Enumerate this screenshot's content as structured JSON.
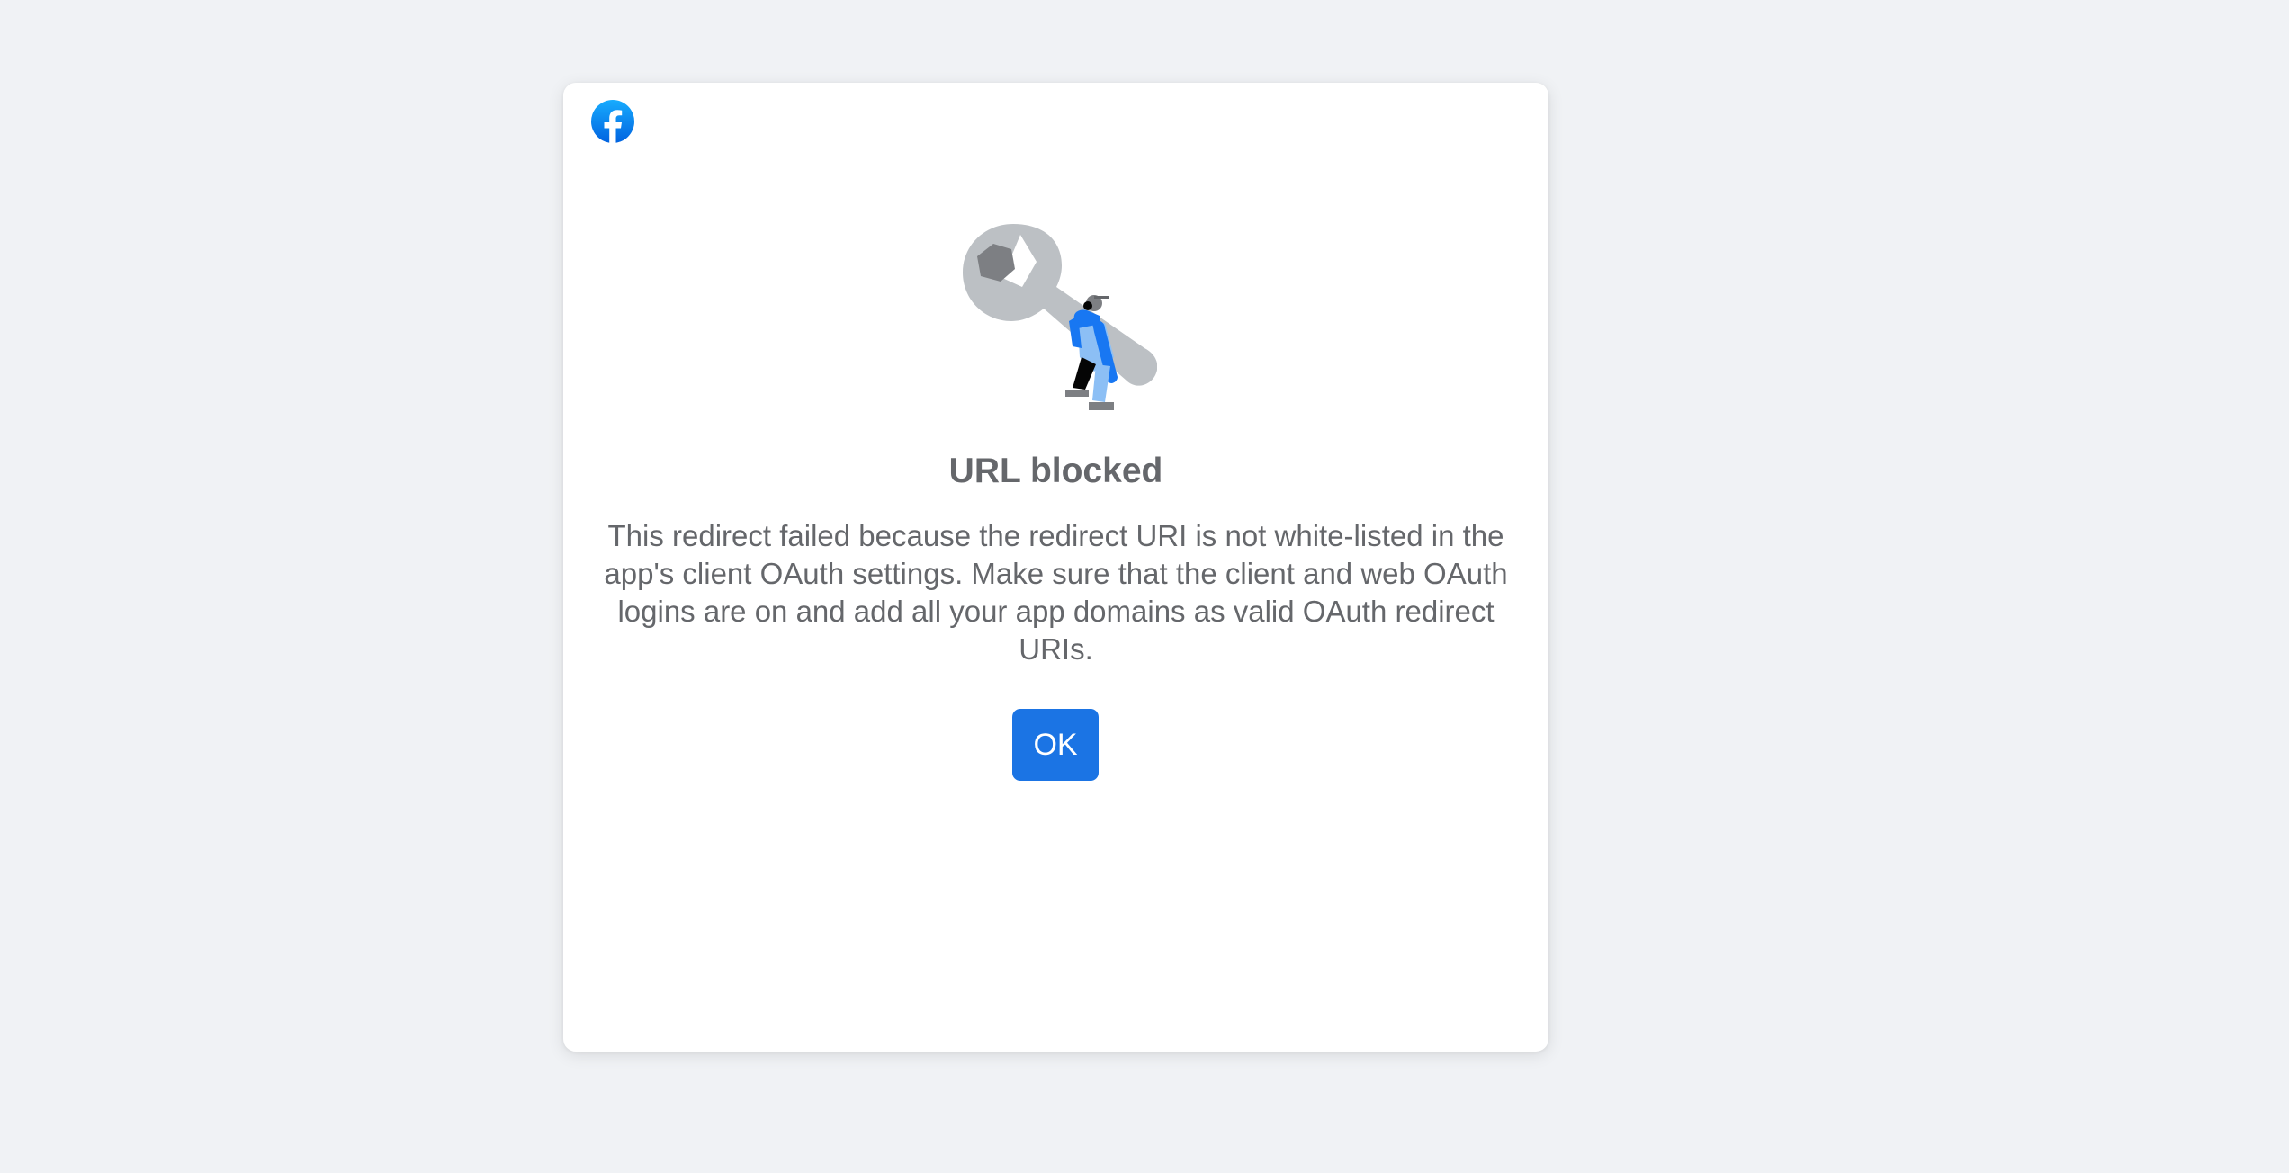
{
  "dialog": {
    "logo_icon": "facebook-logo-icon",
    "illustration_icon": "wrench-maintenance-illustration",
    "title": "URL blocked",
    "message": "This redirect failed because the redirect URI is not white-listed in the app's client OAuth settings. Make sure that the client and web OAuth logins are on and add all your app domains as valid OAuth redirect URIs.",
    "ok_label": "OK"
  },
  "colors": {
    "background": "#f0f2f5",
    "card": "#ffffff",
    "text": "#65676b",
    "brand_blue": "#1b74e4"
  }
}
